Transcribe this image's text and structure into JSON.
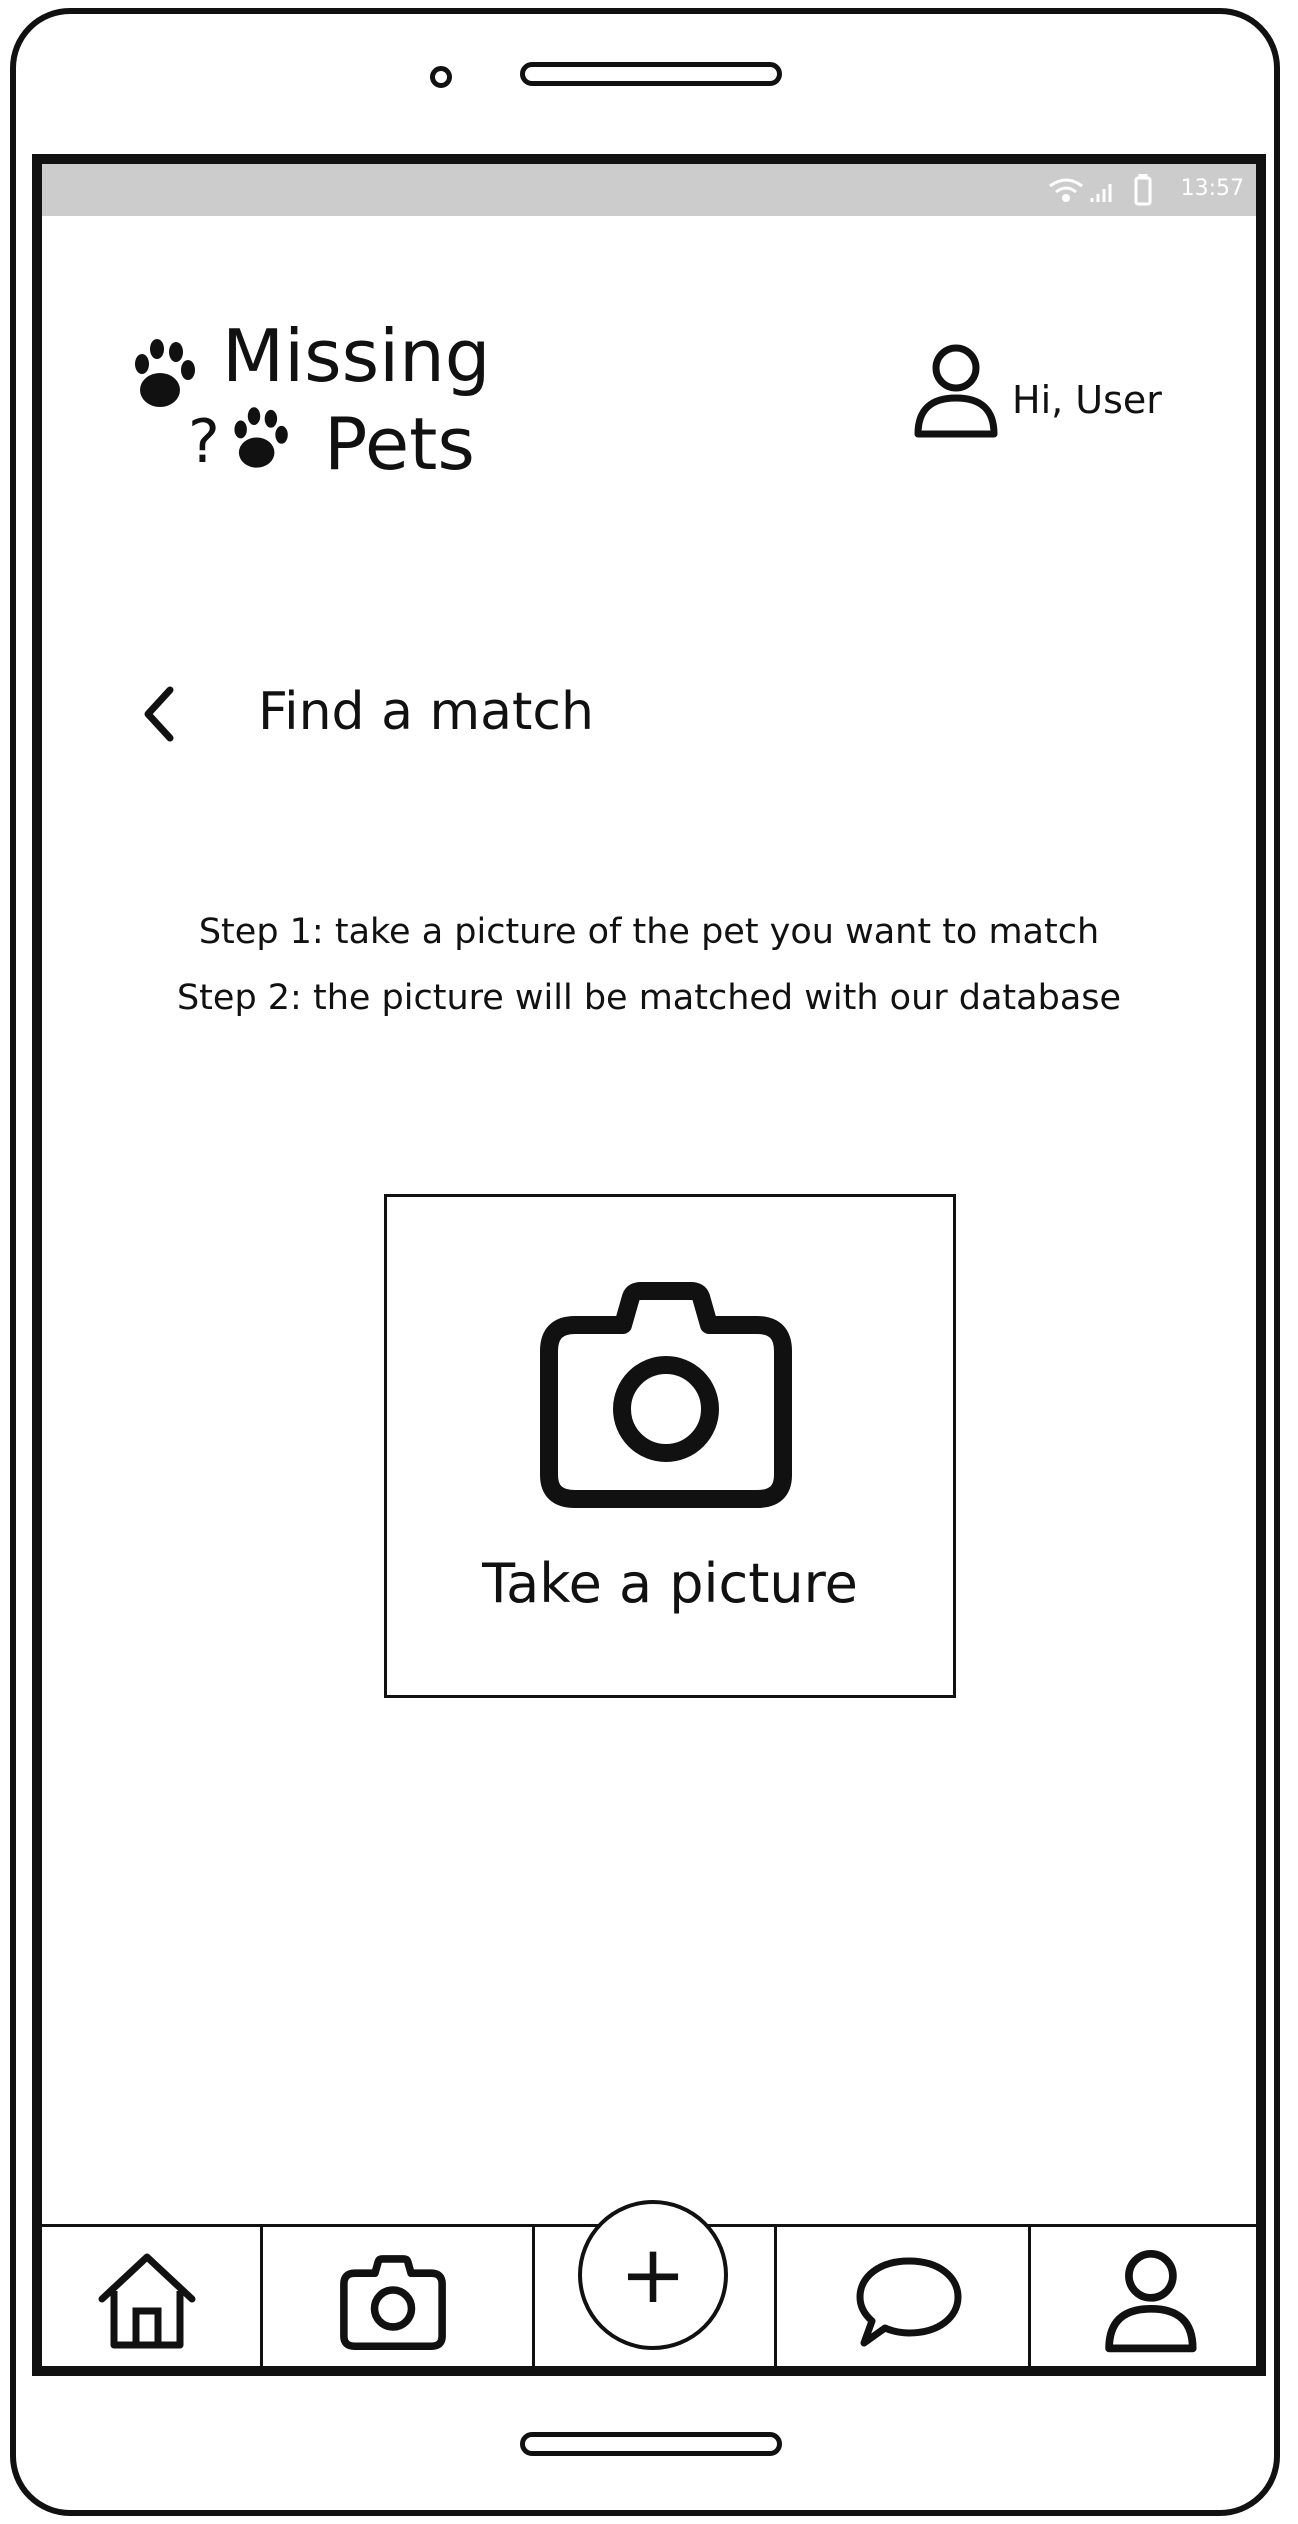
{
  "statusbar": {
    "time": "13:57",
    "icons": [
      "wifi-icon",
      "signal-icon",
      "battery-icon"
    ]
  },
  "header": {
    "logo_line1": "Missing",
    "logo_line2": "Pets",
    "logo_question": "?",
    "greeting": "Hi, User"
  },
  "page": {
    "title": "Find a match"
  },
  "instructions": {
    "step1": "Step 1: take a picture of the pet you want to match",
    "step2": "Step 2: the picture will be matched with our database"
  },
  "camera_card": {
    "label": "Take a picture",
    "icon": "camera-icon"
  },
  "bottom_nav": {
    "items": [
      {
        "icon": "home-icon"
      },
      {
        "icon": "camera-icon"
      },
      {
        "icon": "plus-icon",
        "label": "+"
      },
      {
        "icon": "chat-icon"
      },
      {
        "icon": "user-icon"
      }
    ]
  }
}
